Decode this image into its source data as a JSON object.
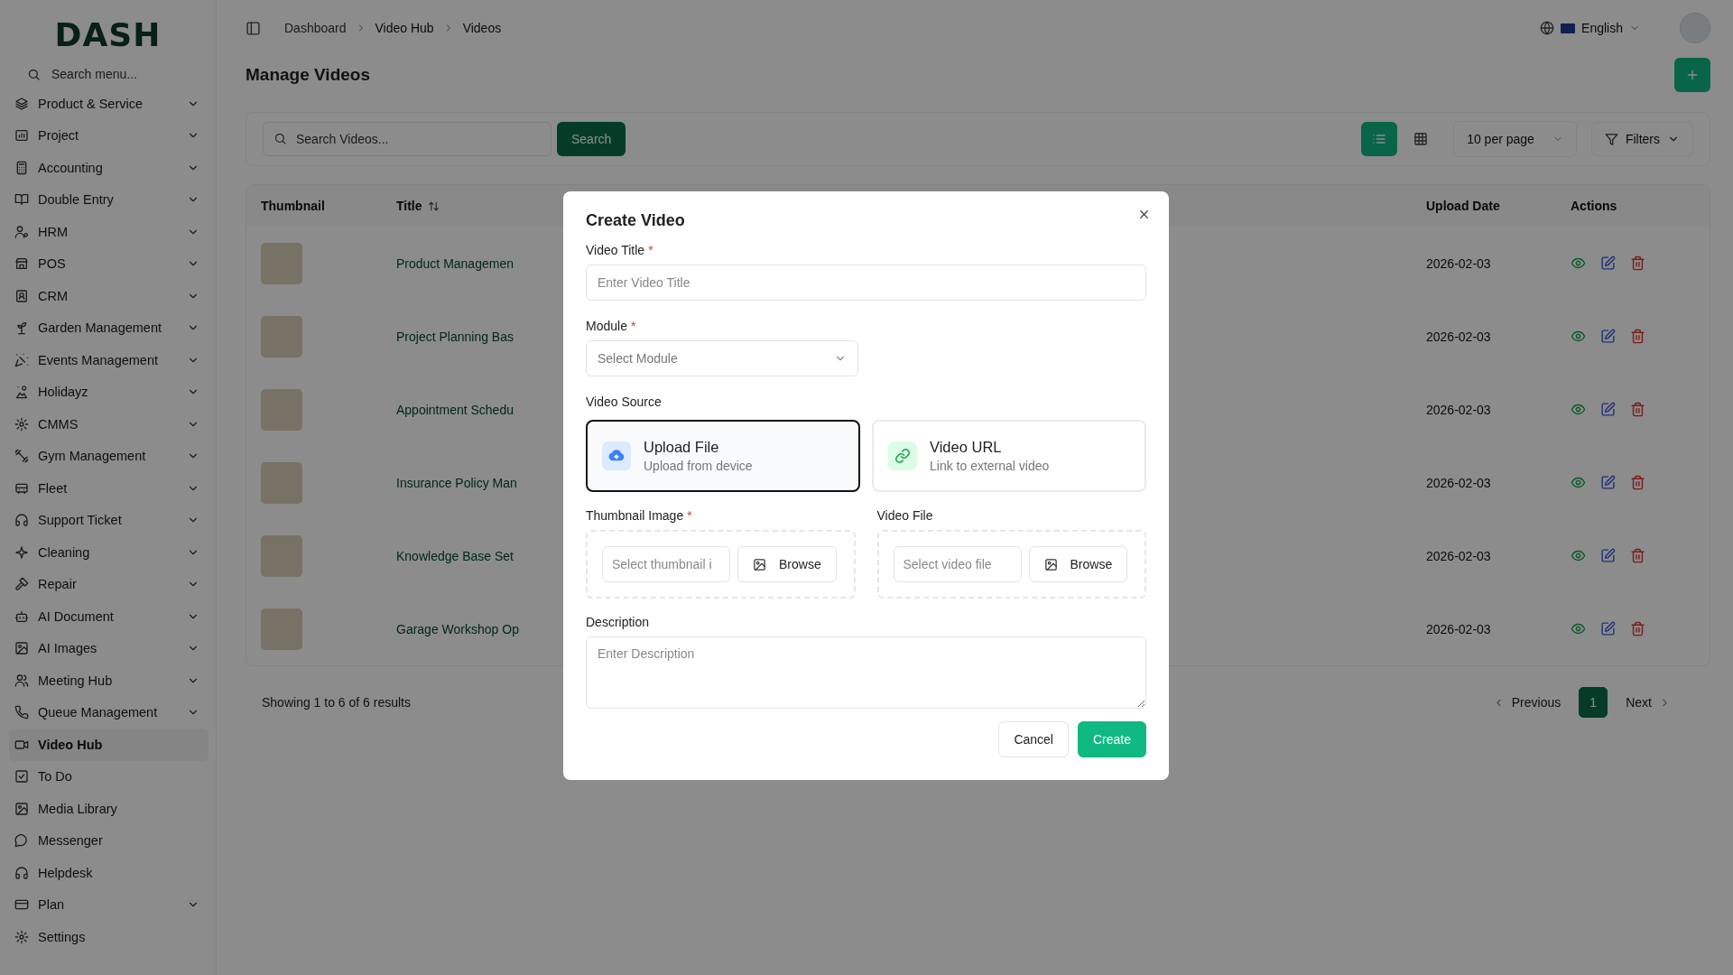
{
  "logo": "DASH",
  "sidebar": {
    "search_placeholder": "Search menu...",
    "items": [
      {
        "label": "Product & Service",
        "has_submenu": true,
        "selected": false
      },
      {
        "label": "Project",
        "has_submenu": true,
        "selected": false
      },
      {
        "label": "Accounting",
        "has_submenu": true,
        "selected": false
      },
      {
        "label": "Double Entry",
        "has_submenu": true,
        "selected": false
      },
      {
        "label": "HRM",
        "has_submenu": true,
        "selected": false
      },
      {
        "label": "POS",
        "has_submenu": true,
        "selected": false
      },
      {
        "label": "CRM",
        "has_submenu": true,
        "selected": false
      },
      {
        "label": "Garden Management",
        "has_submenu": true,
        "selected": false
      },
      {
        "label": "Events Management",
        "has_submenu": true,
        "selected": false
      },
      {
        "label": "Holidayz",
        "has_submenu": true,
        "selected": false
      },
      {
        "label": "CMMS",
        "has_submenu": true,
        "selected": false
      },
      {
        "label": "Gym Management",
        "has_submenu": true,
        "selected": false
      },
      {
        "label": "Fleet",
        "has_submenu": true,
        "selected": false
      },
      {
        "label": "Support Ticket",
        "has_submenu": true,
        "selected": false
      },
      {
        "label": "Cleaning",
        "has_submenu": true,
        "selected": false
      },
      {
        "label": "Repair",
        "has_submenu": true,
        "selected": false
      },
      {
        "label": "AI Document",
        "has_submenu": true,
        "selected": false
      },
      {
        "label": "AI Images",
        "has_submenu": true,
        "selected": false
      },
      {
        "label": "Meeting Hub",
        "has_submenu": true,
        "selected": false
      },
      {
        "label": "Queue Management",
        "has_submenu": true,
        "selected": false
      },
      {
        "label": "Video Hub",
        "has_submenu": false,
        "selected": true
      },
      {
        "label": "To Do",
        "has_submenu": false,
        "selected": false
      },
      {
        "label": "Media Library",
        "has_submenu": false,
        "selected": false
      },
      {
        "label": "Messenger",
        "has_submenu": false,
        "selected": false
      },
      {
        "label": "Helpdesk",
        "has_submenu": false,
        "selected": false
      },
      {
        "label": "Plan",
        "has_submenu": true,
        "selected": false
      },
      {
        "label": "Settings",
        "has_submenu": false,
        "selected": false
      }
    ]
  },
  "breadcrumbs": [
    "Dashboard",
    "Video Hub",
    "Videos"
  ],
  "language": "English",
  "page_title": "Manage Videos",
  "toolbar": {
    "search_placeholder": "Search Videos...",
    "search_button": "Search",
    "view_modes": [
      {
        "kind": "list",
        "selected": true
      },
      {
        "kind": "grid",
        "selected": false
      }
    ],
    "per_page": "10 per page",
    "filters": "Filters"
  },
  "table": {
    "columns": [
      "Thumbnail",
      "Title",
      "Upload Date",
      "Actions"
    ],
    "rows": [
      {
        "title": "Product Managemen",
        "upload_date": "2026-02-03"
      },
      {
        "title": "Project Planning Bas",
        "upload_date": "2026-02-03"
      },
      {
        "title": "Appointment Schedu",
        "upload_date": "2026-02-03"
      },
      {
        "title": "Insurance Policy Man",
        "upload_date": "2026-02-03"
      },
      {
        "title": "Knowledge Base Set",
        "upload_date": "2026-02-03"
      },
      {
        "title": "Garage Workshop Op",
        "upload_date": "2026-02-03"
      }
    ]
  },
  "pagination": {
    "summary": "Showing 1 to 6 of 6 results",
    "previous": "Previous",
    "pages": [
      {
        "label": "1",
        "selected": true
      }
    ],
    "next": "Next"
  },
  "dialog": {
    "title": "Create Video",
    "video_title": {
      "label": "Video Title",
      "required_mark": "*",
      "placeholder": "Enter Video Title"
    },
    "module": {
      "label": "Module",
      "required_mark": "*",
      "placeholder": "Select Module"
    },
    "video_source": {
      "label": "Video Source",
      "options": [
        {
          "kind": "upload",
          "title": "Upload File",
          "subtitle": "Upload from device",
          "selected": true
        },
        {
          "kind": "url",
          "title": "Video URL",
          "subtitle": "Link to external video",
          "selected": false
        }
      ]
    },
    "uploads": [
      {
        "label": "Thumbnail Image",
        "required_mark": "*",
        "placeholder": "Select thumbnail i",
        "button": "Browse"
      },
      {
        "label": "Video File",
        "placeholder": "Select video file",
        "button": "Browse"
      }
    ],
    "description": {
      "label": "Description",
      "placeholder": "Enter Description"
    },
    "buttons": [
      {
        "kind": "secondary",
        "label": "Cancel"
      },
      {
        "kind": "primary",
        "label": "Create"
      }
    ]
  }
}
